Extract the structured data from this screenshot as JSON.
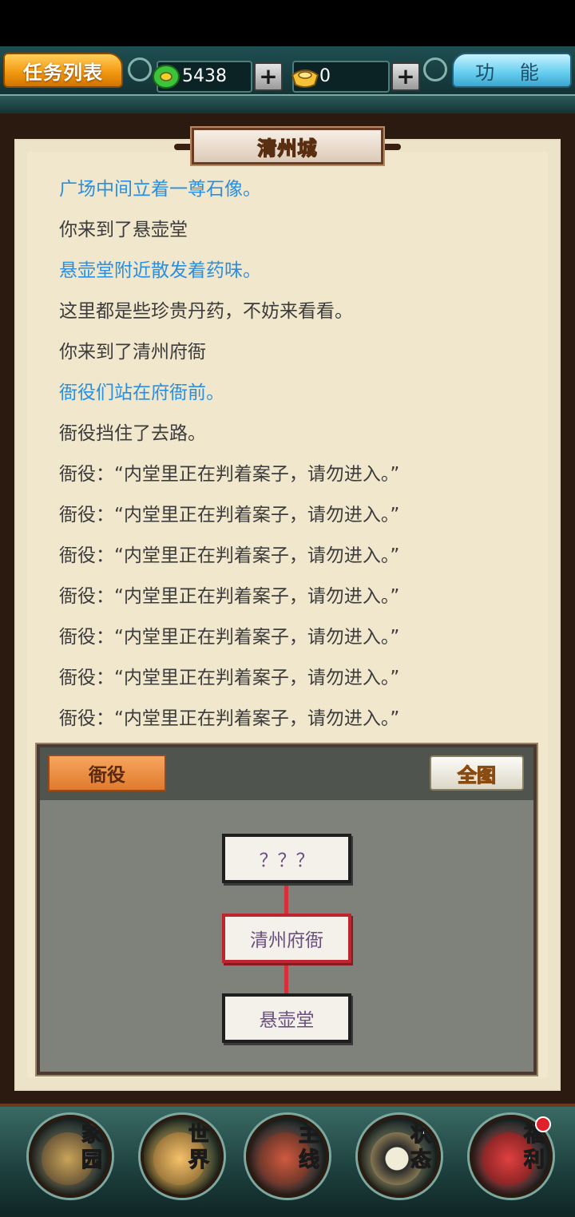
{
  "header": {
    "task_list_label": "任务列表",
    "function_label": "功 能",
    "jade_amount": "5438",
    "gold_amount": "0",
    "plus_label": "+"
  },
  "panel": {
    "location_title": "清州城",
    "log": [
      {
        "text": "广场中间立着一尊石像。",
        "style": "blue"
      },
      {
        "text": "你来到了悬壶堂",
        "style": "normal"
      },
      {
        "text": "悬壶堂附近散发着药味。",
        "style": "blue"
      },
      {
        "text": "这里都是些珍贵丹药，不妨来看看。",
        "style": "normal"
      },
      {
        "text": "你来到了清州府衙",
        "style": "normal"
      },
      {
        "text": "衙役们站在府衙前。",
        "style": "blue"
      },
      {
        "text": "衙役挡住了去路。",
        "style": "normal"
      },
      {
        "text": "衙役：“内堂里正在判着案子，请勿进入。”",
        "style": "normal"
      },
      {
        "text": "衙役：“内堂里正在判着案子，请勿进入。”",
        "style": "normal"
      },
      {
        "text": "衙役：“内堂里正在判着案子，请勿进入。”",
        "style": "normal"
      },
      {
        "text": "衙役：“内堂里正在判着案子，请勿进入。”",
        "style": "normal"
      },
      {
        "text": "衙役：“内堂里正在判着案子，请勿进入。”",
        "style": "normal"
      },
      {
        "text": "衙役：“内堂里正在判着案子，请勿进入。”",
        "style": "normal"
      },
      {
        "text": "衙役：“内堂里正在判着案子，请勿进入。”",
        "style": "normal"
      }
    ]
  },
  "map": {
    "npc_button_label": "衙役",
    "full_map_label": "全图",
    "nodes": {
      "north": "？？？",
      "current": "清州府衙",
      "south": "悬壶堂"
    }
  },
  "nav": {
    "home": [
      "家",
      "园"
    ],
    "world": [
      "世",
      "界"
    ],
    "main_quest": [
      "主",
      "线"
    ],
    "status": [
      "状",
      "态"
    ],
    "welfare": [
      "福",
      "利"
    ]
  },
  "colors": {
    "log_blue": "#2a8fe0",
    "log_normal": "#3c3c3c",
    "current_node_border": "#c0242e",
    "task_button": "#f39a12",
    "function_button": "#6ad0f0"
  },
  "icons": [
    "jade-coin-icon",
    "gold-ingot-icon",
    "plus-icon",
    "notification-badge-icon"
  ]
}
